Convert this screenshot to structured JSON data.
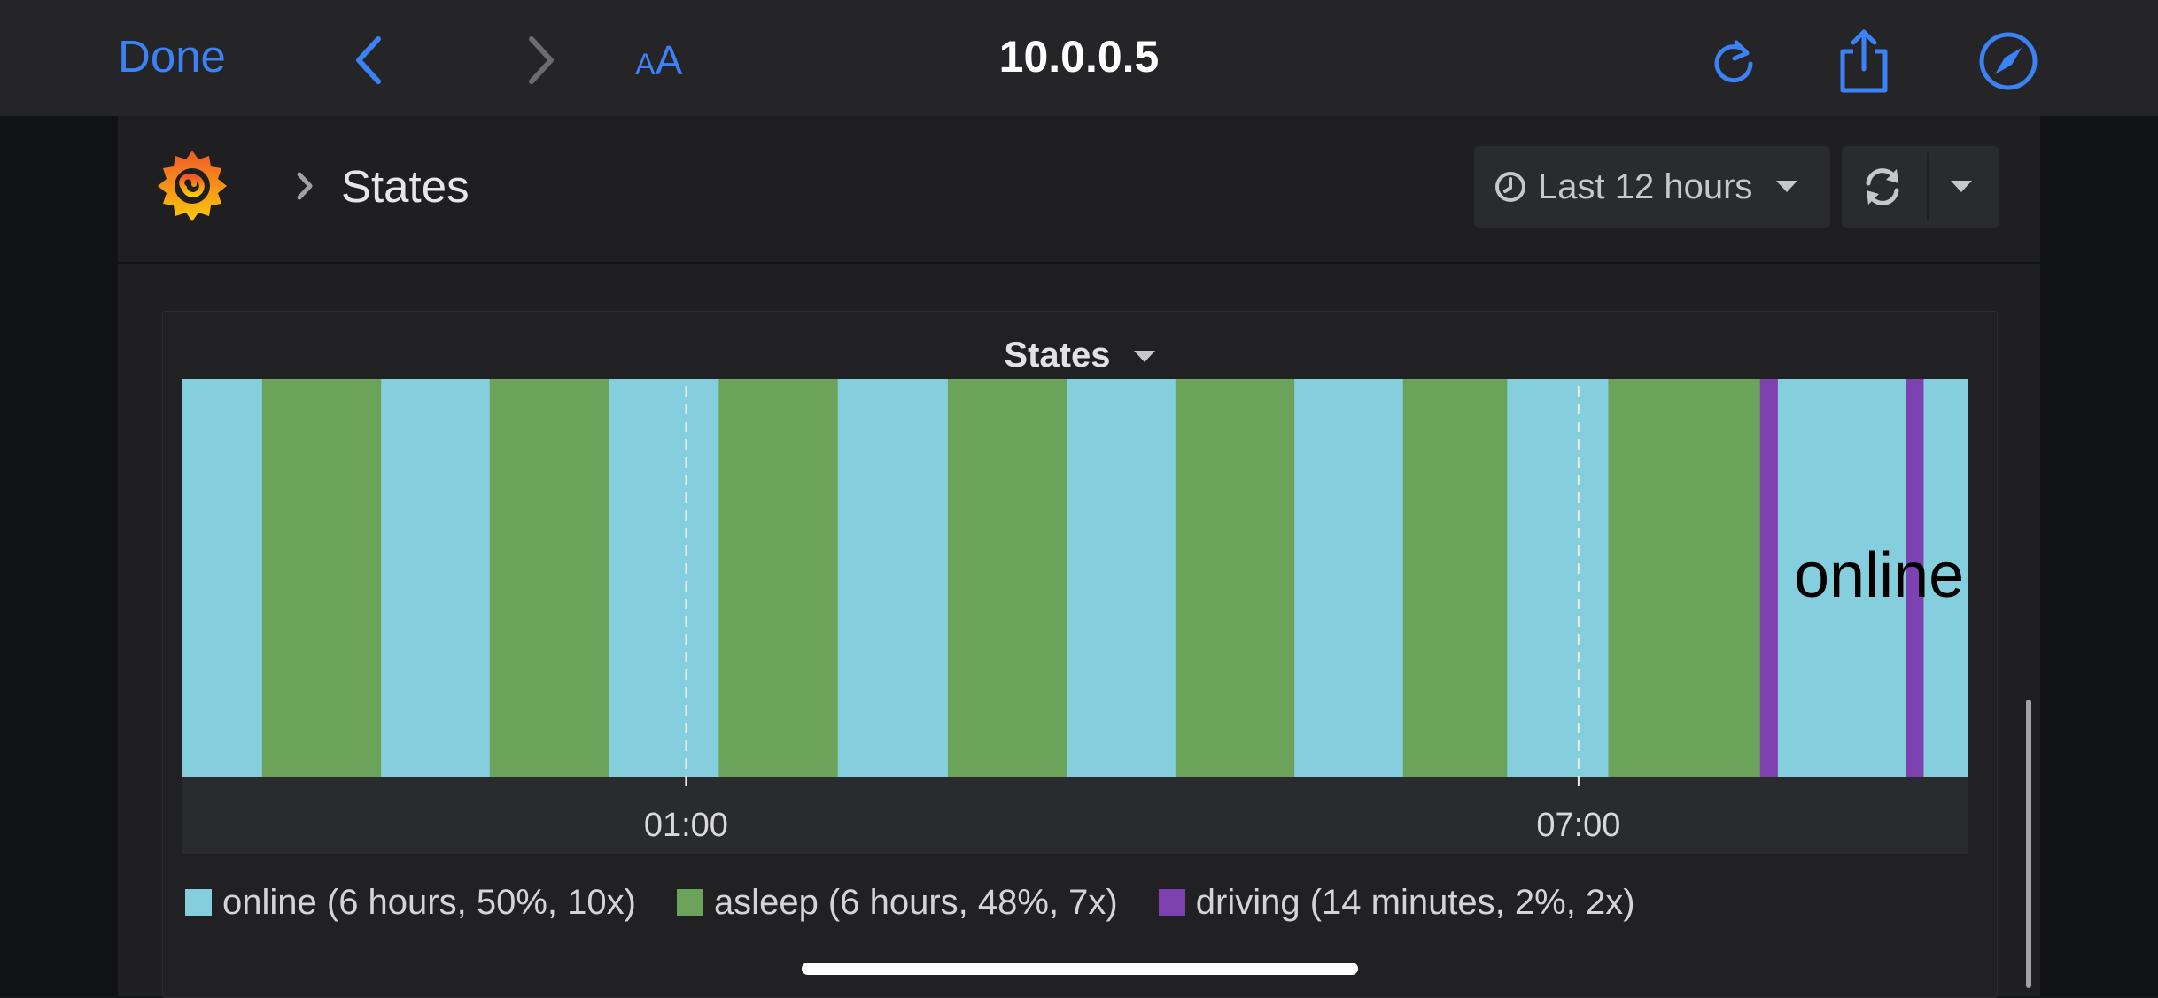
{
  "browser": {
    "done_label": "Done",
    "font_size_small": "A",
    "font_size_big": "A",
    "url": "10.0.0.5",
    "icons": [
      "chevron-left-icon",
      "chevron-right-icon",
      "reload-icon",
      "share-icon",
      "compass-icon"
    ],
    "accent_color": "#3b82f6"
  },
  "dashboard": {
    "breadcrumb_title": "States",
    "time_range_label": "Last 12 hours",
    "icons": [
      "grafana-logo",
      "chevron-right-icon",
      "clock-icon",
      "caret-down-icon",
      "refresh-icon"
    ]
  },
  "panel": {
    "title": "States",
    "chart_data": {
      "type": "state-timeline",
      "title": "States",
      "x_axis_ticks": [
        "01:00",
        "07:00"
      ],
      "x_range_hours": [
        -2.385,
        9.615
      ],
      "tick_hours": [
        1,
        7
      ],
      "state_colors": {
        "online": "#85cedd",
        "asleep": "#6aa359",
        "driving": "#7e42b0"
      },
      "segments": [
        {
          "state": "online",
          "start": -2.385,
          "end": -1.85
        },
        {
          "state": "asleep",
          "start": -1.85,
          "end": -1.05
        },
        {
          "state": "online",
          "start": -1.05,
          "end": -0.32
        },
        {
          "state": "asleep",
          "start": -0.32,
          "end": 0.48
        },
        {
          "state": "online",
          "start": 0.48,
          "end": 1.22
        },
        {
          "state": "asleep",
          "start": 1.22,
          "end": 2.02
        },
        {
          "state": "online",
          "start": 2.02,
          "end": 2.76
        },
        {
          "state": "asleep",
          "start": 2.76,
          "end": 3.56
        },
        {
          "state": "online",
          "start": 3.56,
          "end": 4.29
        },
        {
          "state": "asleep",
          "start": 4.29,
          "end": 5.09
        },
        {
          "state": "online",
          "start": 5.09,
          "end": 5.82
        },
        {
          "state": "asleep",
          "start": 5.82,
          "end": 6.52
        },
        {
          "state": "online",
          "start": 6.52,
          "end": 7.2
        },
        {
          "state": "asleep",
          "start": 7.2,
          "end": 8.22
        },
        {
          "state": "driving",
          "start": 8.22,
          "end": 8.34
        },
        {
          "state": "online",
          "start": 8.34,
          "end": 9.2
        },
        {
          "state": "driving",
          "start": 9.2,
          "end": 9.32
        },
        {
          "state": "online",
          "start": 9.32,
          "end": 9.615
        }
      ],
      "hover_label": "online",
      "legend": [
        {
          "state": "online",
          "label": "online (6 hours, 50%, 10x)"
        },
        {
          "state": "asleep",
          "label": "asleep (6 hours, 48%, 7x)"
        },
        {
          "state": "driving",
          "label": "driving (14 minutes, 2%, 2x)"
        }
      ]
    }
  }
}
